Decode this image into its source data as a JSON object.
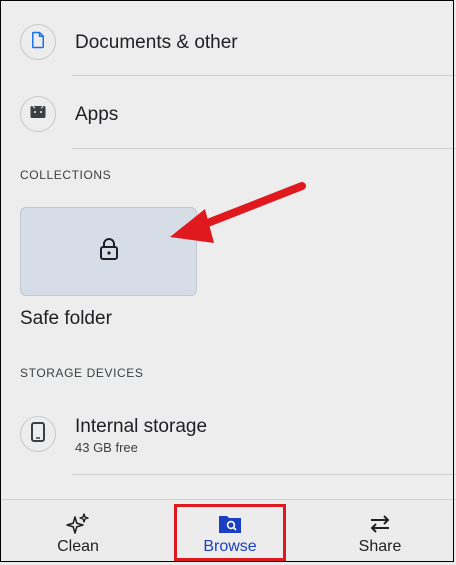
{
  "list": {
    "documents_label": "Documents & other",
    "apps_label": "Apps"
  },
  "collections": {
    "header": "COLLECTIONS",
    "safe_folder_label": "Safe folder"
  },
  "storage": {
    "header": "STORAGE DEVICES",
    "internal_label": "Internal storage",
    "internal_free": "43 GB free"
  },
  "bottom_nav": {
    "clean": "Clean",
    "browse": "Browse",
    "share": "Share",
    "active": "browse"
  },
  "colors": {
    "accent": "#1a3fc0",
    "annotation_red": "#e0191f",
    "safe_card": "#d7dde6"
  },
  "icons": {
    "documents": "document-icon",
    "apps": "apps-icon",
    "safe_folder": "lock-icon",
    "internal_storage": "phone-icon",
    "clean": "sparkle-icon",
    "browse": "browse-folder-icon",
    "share": "swap-arrows-icon"
  }
}
